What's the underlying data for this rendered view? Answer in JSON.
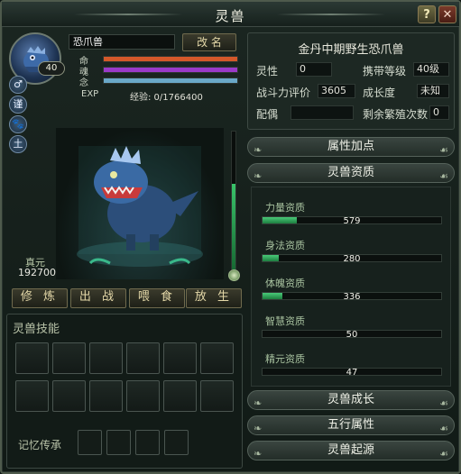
{
  "window": {
    "title": "灵兽"
  },
  "title_buttons": {
    "help": "?",
    "close": "✕"
  },
  "pet": {
    "name": "恐爪兽",
    "level": "40",
    "rename_label": "改 名",
    "bars": [
      {
        "label": "命",
        "fraction": 1.0,
        "color": "#d4582a"
      },
      {
        "label": "魂",
        "fraction": 1.0,
        "color": "#9a3ac8"
      },
      {
        "label": "念",
        "fraction": 1.0,
        "color": "#6aa8c8"
      }
    ],
    "exp_label": "EXP",
    "exp_text": "经验: 0/1766400",
    "zhenyuan_label": "真元",
    "zhenyuan_value": "192700",
    "vertical_bar_fraction": 0.62
  },
  "side_icons": [
    {
      "glyph": "♂",
      "name": "male-icon"
    },
    {
      "glyph": "谨",
      "name": "temperament-icon"
    },
    {
      "glyph": "🐾",
      "name": "paw-icon"
    },
    {
      "glyph": "土",
      "name": "earth-element-icon"
    }
  ],
  "actions": [
    "修 炼",
    "出 战",
    "喂 食",
    "放 生"
  ],
  "skills": {
    "title": "灵兽技能",
    "memory_label": "记忆传承"
  },
  "info": {
    "title": "金丹中期野生恐爪兽",
    "lingxing_label": "灵性",
    "lingxing_value": "0",
    "carry_level_label": "携带等级",
    "carry_level_value": "40级",
    "combat_label": "战斗力评价",
    "combat_value": "3605",
    "growth_label": "成长度",
    "growth_value": "未知",
    "mate_label": "配偶",
    "mate_value": "",
    "breed_label": "剩余繁殖次数",
    "breed_value": "0"
  },
  "sections": {
    "attr_points": "属性加点",
    "aptitude": "灵兽资质",
    "growth": "灵兽成长",
    "five_elements": "五行属性",
    "origin": "灵兽起源"
  },
  "aptitudes": [
    {
      "label": "力量资质",
      "value": "579",
      "fraction": 0.19
    },
    {
      "label": "身法资质",
      "value": "280",
      "fraction": 0.09
    },
    {
      "label": "体魄资质",
      "value": "336",
      "fraction": 0.11
    },
    {
      "label": "智慧资质",
      "value": "50",
      "fraction": 0.0
    },
    {
      "label": "精元资质",
      "value": "47",
      "fraction": 0.0
    }
  ]
}
